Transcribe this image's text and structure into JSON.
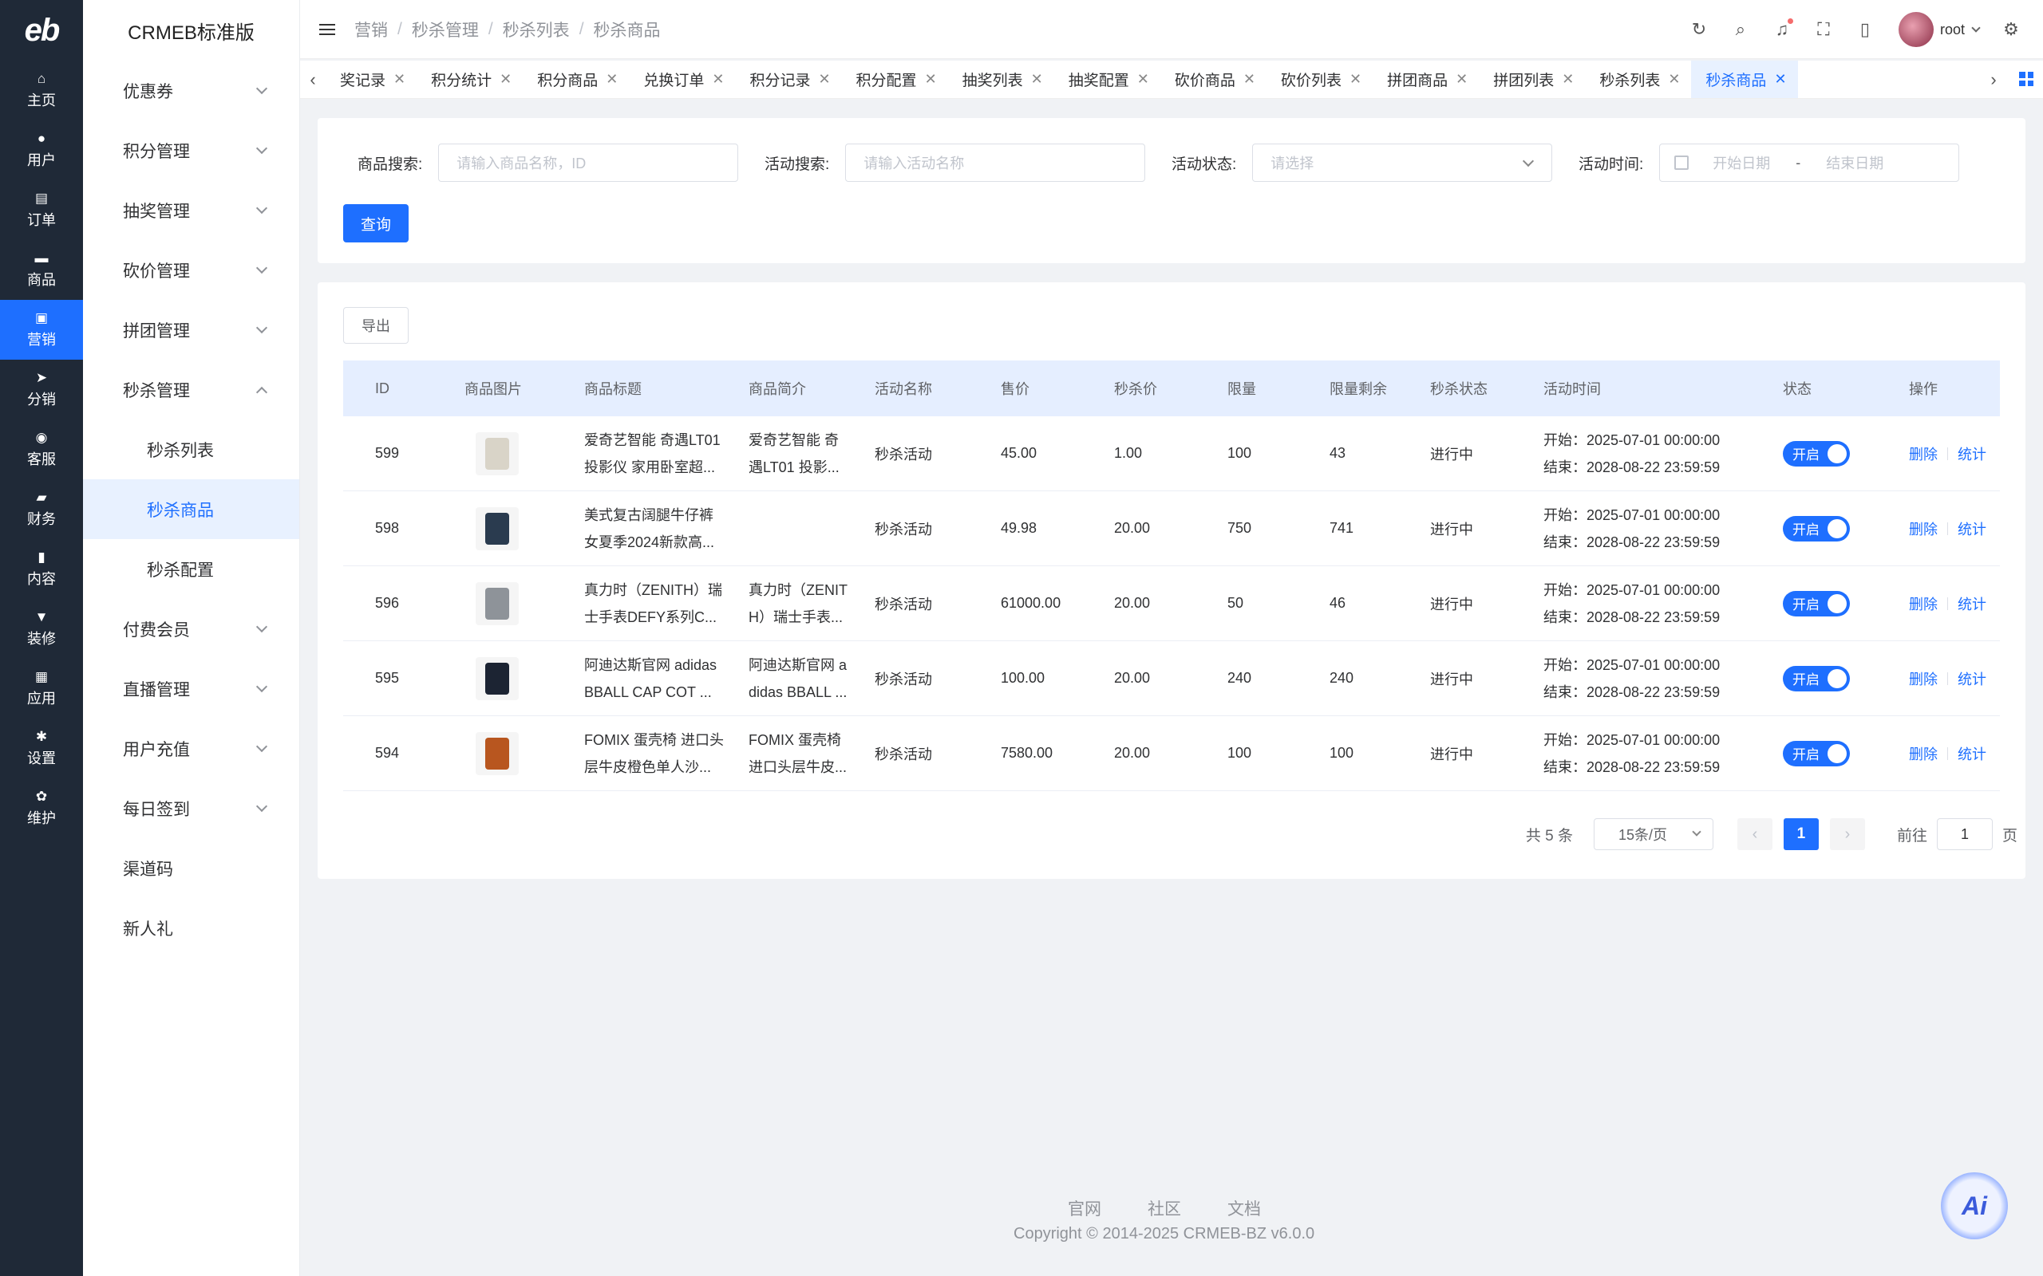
{
  "rail": {
    "logo": "eb",
    "items": [
      {
        "label": "主页",
        "icon": "home-icon"
      },
      {
        "label": "用户",
        "icon": "user-icon"
      },
      {
        "label": "订单",
        "icon": "order-icon"
      },
      {
        "label": "商品",
        "icon": "product-icon"
      },
      {
        "label": "营销",
        "icon": "marketing-icon"
      },
      {
        "label": "分销",
        "icon": "distribution-icon"
      },
      {
        "label": "客服",
        "icon": "service-icon"
      },
      {
        "label": "财务",
        "icon": "finance-icon"
      },
      {
        "label": "内容",
        "icon": "content-icon"
      },
      {
        "label": "装修",
        "icon": "decoration-icon"
      },
      {
        "label": "应用",
        "icon": "apps-icon"
      },
      {
        "label": "设置",
        "icon": "settings-icon"
      },
      {
        "label": "维护",
        "icon": "maintenance-icon"
      }
    ]
  },
  "submenu": {
    "brand": "CRMEB标准版",
    "items": [
      {
        "label": "优惠券"
      },
      {
        "label": "积分管理"
      },
      {
        "label": "抽奖管理"
      },
      {
        "label": "砍价管理"
      },
      {
        "label": "拼团管理"
      },
      {
        "label": "秒杀管理"
      },
      {
        "label": "秒杀列表"
      },
      {
        "label": "秒杀商品"
      },
      {
        "label": "秒杀配置"
      },
      {
        "label": "付费会员"
      },
      {
        "label": "直播管理"
      },
      {
        "label": "用户充值"
      },
      {
        "label": "每日签到"
      },
      {
        "label": "渠道码"
      },
      {
        "label": "新人礼"
      }
    ]
  },
  "header": {
    "breadcrumb": [
      "营销",
      "秒杀管理",
      "秒杀列表",
      "秒杀商品"
    ],
    "separator": "/",
    "username": "root"
  },
  "tabs": [
    "奖记录",
    "积分统计",
    "积分商品",
    "兑换订单",
    "积分记录",
    "积分配置",
    "抽奖列表",
    "抽奖配置",
    "砍价商品",
    "砍价列表",
    "拼团商品",
    "拼团列表",
    "秒杀列表",
    "秒杀商品"
  ],
  "filter": {
    "product_label": "商品搜索:",
    "product_placeholder": "请输入商品名称，ID",
    "activity_label": "活动搜索:",
    "activity_placeholder": "请输入活动名称",
    "status_label": "活动状态:",
    "status_placeholder": "请选择",
    "time_label": "活动时间:",
    "start_placeholder": "开始日期",
    "range_sep": "-",
    "end_placeholder": "结束日期",
    "query_button": "查询"
  },
  "table": {
    "export_button": "导出",
    "columns": [
      "ID",
      "商品图片",
      "商品标题",
      "商品简介",
      "活动名称",
      "售价",
      "秒杀价",
      "限量",
      "限量剩余",
      "秒杀状态",
      "活动时间",
      "状态",
      "操作"
    ],
    "rows": [
      {
        "id": "599",
        "title1": "爱奇艺智能 奇遇LT01",
        "title2": "投影仪 家用卧室超...",
        "intro1": "爱奇艺智能 奇",
        "intro2": "遇LT01 投影...",
        "activity": "秒杀活动",
        "price": "45.00",
        "seckill": "1.00",
        "quota": "100",
        "remain": "43",
        "state": "进行中",
        "start": "开始：2025-07-01 00:00:00",
        "end": "结束：2028-08-22 23:59:59",
        "switch": "开启",
        "del": "删除",
        "stat": "统计",
        "thumb_color": "#d9d4c8"
      },
      {
        "id": "598",
        "title1": "美式复古阔腿牛仔裤",
        "title2": "女夏季2024新款高...",
        "intro1": "",
        "intro2": "",
        "activity": "秒杀活动",
        "price": "49.98",
        "seckill": "20.00",
        "quota": "750",
        "remain": "741",
        "state": "进行中",
        "start": "开始：2025-07-01 00:00:00",
        "end": "结束：2028-08-22 23:59:59",
        "switch": "开启",
        "del": "删除",
        "stat": "统计",
        "thumb_color": "#2a3b4f"
      },
      {
        "id": "596",
        "title1": "真力时（ZENITH）瑞",
        "title2": "士手表DEFY系列C...",
        "intro1": "真力时（ZENIT",
        "intro2": "H）瑞士手表...",
        "activity": "秒杀活动",
        "price": "61000.00",
        "seckill": "20.00",
        "quota": "50",
        "remain": "46",
        "state": "进行中",
        "start": "开始：2025-07-01 00:00:00",
        "end": "结束：2028-08-22 23:59:59",
        "switch": "开启",
        "del": "删除",
        "stat": "统计",
        "thumb_color": "#8e9399"
      },
      {
        "id": "595",
        "title1": "阿迪达斯官网 adidas",
        "title2": "BBALL CAP COT ...",
        "intro1": "阿迪达斯官网 a",
        "intro2": "didas BBALL ...",
        "activity": "秒杀活动",
        "price": "100.00",
        "seckill": "20.00",
        "quota": "240",
        "remain": "240",
        "state": "进行中",
        "start": "开始：2025-07-01 00:00:00",
        "end": "结束：2028-08-22 23:59:59",
        "switch": "开启",
        "del": "删除",
        "stat": "统计",
        "thumb_color": "#1c2433"
      },
      {
        "id": "594",
        "title1": "FOMIX 蛋壳椅 进口头",
        "title2": "层牛皮橙色单人沙...",
        "intro1": "FOMIX 蛋壳椅",
        "intro2": "进口头层牛皮...",
        "activity": "秒杀活动",
        "price": "7580.00",
        "seckill": "20.00",
        "quota": "100",
        "remain": "100",
        "state": "进行中",
        "start": "开始：2025-07-01 00:00:00",
        "end": "结束：2028-08-22 23:59:59",
        "switch": "开启",
        "del": "删除",
        "stat": "统计",
        "thumb_color": "#b8561f"
      }
    ]
  },
  "pagination": {
    "total": "共 5 条",
    "page_size": "15条/页",
    "current": "1",
    "goto_label": "前往",
    "goto_value": "1",
    "page_unit": "页"
  },
  "footer": {
    "links": [
      "官网",
      "社区",
      "文档"
    ],
    "copyright": "Copyright © 2014-2025 CRMEB-BZ v6.0.0"
  },
  "ai_button": "Ai",
  "colors": {
    "accent": "#1e6fff",
    "rail_bg": "#1f2937"
  }
}
